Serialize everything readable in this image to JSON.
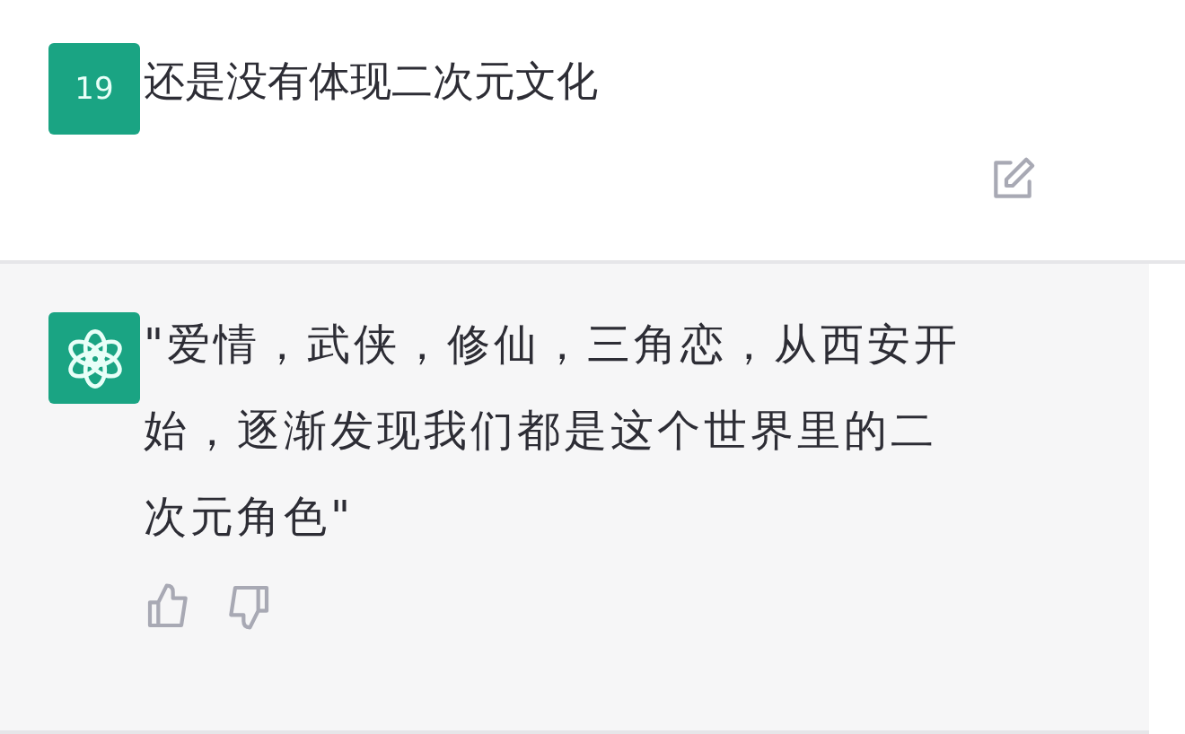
{
  "user_message": {
    "avatar": "19",
    "text": "还是没有体现二次元文化"
  },
  "assistant_message": {
    "text": "\"爱情，武侠，修仙，三角恋，从西安开始，逐渐发现我们都是这个世界里的二次元角色\""
  }
}
